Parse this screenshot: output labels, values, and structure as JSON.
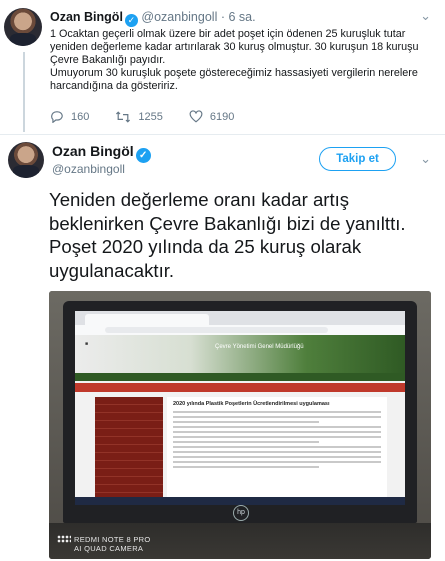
{
  "tweet1": {
    "name": "Ozan Bingöl",
    "handle": "@ozanbingoll",
    "time": "· 6 sa.",
    "paragraphs": [
      "1 Ocaktan geçerli olmak üzere bir adet poşet için ödenen 25 kuruşluk tutar yeniden değerleme kadar artırılarak 30 kuruş olmuştur. 30 kuruşun 18 kuruşu Çevre Bakanlığı payıdır.",
      "Umuyorum 30 kuruşluk poşete göstereceğimiz hassasiyeti vergilerin nerelere harcandığına da gösteririz."
    ],
    "replies": "160",
    "retweets": "1255",
    "likes": "6190"
  },
  "tweet2": {
    "name": "Ozan Bingöl",
    "handle": "@ozanbingoll",
    "follow_label": "Takip et",
    "text": "Yeniden değerleme oranı kadar artış beklenirken Çevre Bakanlığı bizi de yanılttı. Poşet 2020 yılında da 25 kuruş olarak uygulanacaktır."
  },
  "photo": {
    "site_title": "Çevre Yönetimi Genel Müdürlüğü",
    "article_title": "2020 yılında Plastik Poşetlerin Ücretlendirilmesi uygulaması",
    "camera_watermark_line1": "REDMI NOTE 8 PRO",
    "camera_watermark_line2": "AI QUAD CAMERA",
    "laptop_brand": "hp"
  },
  "colors": {
    "accent": "#1da1f2",
    "muted": "#657786",
    "site_red": "#c0392b",
    "site_green": "#2f5a24"
  }
}
